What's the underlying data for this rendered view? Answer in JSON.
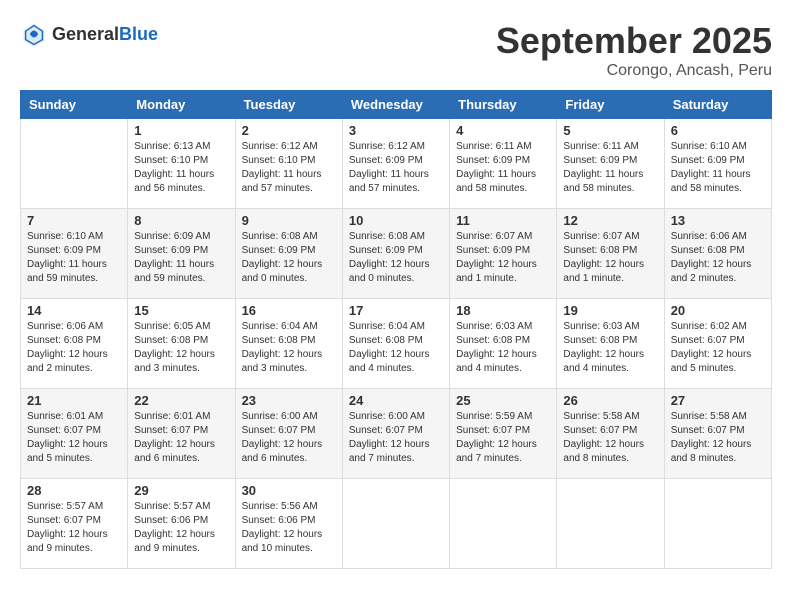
{
  "logo": {
    "text_general": "General",
    "text_blue": "Blue"
  },
  "header": {
    "month": "September 2025",
    "location": "Corongo, Ancash, Peru"
  },
  "weekdays": [
    "Sunday",
    "Monday",
    "Tuesday",
    "Wednesday",
    "Thursday",
    "Friday",
    "Saturday"
  ],
  "weeks": [
    [
      {
        "day": "",
        "info": ""
      },
      {
        "day": "1",
        "info": "Sunrise: 6:13 AM\nSunset: 6:10 PM\nDaylight: 11 hours\nand 56 minutes."
      },
      {
        "day": "2",
        "info": "Sunrise: 6:12 AM\nSunset: 6:10 PM\nDaylight: 11 hours\nand 57 minutes."
      },
      {
        "day": "3",
        "info": "Sunrise: 6:12 AM\nSunset: 6:09 PM\nDaylight: 11 hours\nand 57 minutes."
      },
      {
        "day": "4",
        "info": "Sunrise: 6:11 AM\nSunset: 6:09 PM\nDaylight: 11 hours\nand 58 minutes."
      },
      {
        "day": "5",
        "info": "Sunrise: 6:11 AM\nSunset: 6:09 PM\nDaylight: 11 hours\nand 58 minutes."
      },
      {
        "day": "6",
        "info": "Sunrise: 6:10 AM\nSunset: 6:09 PM\nDaylight: 11 hours\nand 58 minutes."
      }
    ],
    [
      {
        "day": "7",
        "info": "Sunrise: 6:10 AM\nSunset: 6:09 PM\nDaylight: 11 hours\nand 59 minutes."
      },
      {
        "day": "8",
        "info": "Sunrise: 6:09 AM\nSunset: 6:09 PM\nDaylight: 11 hours\nand 59 minutes."
      },
      {
        "day": "9",
        "info": "Sunrise: 6:08 AM\nSunset: 6:09 PM\nDaylight: 12 hours\nand 0 minutes."
      },
      {
        "day": "10",
        "info": "Sunrise: 6:08 AM\nSunset: 6:09 PM\nDaylight: 12 hours\nand 0 minutes."
      },
      {
        "day": "11",
        "info": "Sunrise: 6:07 AM\nSunset: 6:09 PM\nDaylight: 12 hours\nand 1 minute."
      },
      {
        "day": "12",
        "info": "Sunrise: 6:07 AM\nSunset: 6:08 PM\nDaylight: 12 hours\nand 1 minute."
      },
      {
        "day": "13",
        "info": "Sunrise: 6:06 AM\nSunset: 6:08 PM\nDaylight: 12 hours\nand 2 minutes."
      }
    ],
    [
      {
        "day": "14",
        "info": "Sunrise: 6:06 AM\nSunset: 6:08 PM\nDaylight: 12 hours\nand 2 minutes."
      },
      {
        "day": "15",
        "info": "Sunrise: 6:05 AM\nSunset: 6:08 PM\nDaylight: 12 hours\nand 3 minutes."
      },
      {
        "day": "16",
        "info": "Sunrise: 6:04 AM\nSunset: 6:08 PM\nDaylight: 12 hours\nand 3 minutes."
      },
      {
        "day": "17",
        "info": "Sunrise: 6:04 AM\nSunset: 6:08 PM\nDaylight: 12 hours\nand 4 minutes."
      },
      {
        "day": "18",
        "info": "Sunrise: 6:03 AM\nSunset: 6:08 PM\nDaylight: 12 hours\nand 4 minutes."
      },
      {
        "day": "19",
        "info": "Sunrise: 6:03 AM\nSunset: 6:08 PM\nDaylight: 12 hours\nand 4 minutes."
      },
      {
        "day": "20",
        "info": "Sunrise: 6:02 AM\nSunset: 6:07 PM\nDaylight: 12 hours\nand 5 minutes."
      }
    ],
    [
      {
        "day": "21",
        "info": "Sunrise: 6:01 AM\nSunset: 6:07 PM\nDaylight: 12 hours\nand 5 minutes."
      },
      {
        "day": "22",
        "info": "Sunrise: 6:01 AM\nSunset: 6:07 PM\nDaylight: 12 hours\nand 6 minutes."
      },
      {
        "day": "23",
        "info": "Sunrise: 6:00 AM\nSunset: 6:07 PM\nDaylight: 12 hours\nand 6 minutes."
      },
      {
        "day": "24",
        "info": "Sunrise: 6:00 AM\nSunset: 6:07 PM\nDaylight: 12 hours\nand 7 minutes."
      },
      {
        "day": "25",
        "info": "Sunrise: 5:59 AM\nSunset: 6:07 PM\nDaylight: 12 hours\nand 7 minutes."
      },
      {
        "day": "26",
        "info": "Sunrise: 5:58 AM\nSunset: 6:07 PM\nDaylight: 12 hours\nand 8 minutes."
      },
      {
        "day": "27",
        "info": "Sunrise: 5:58 AM\nSunset: 6:07 PM\nDaylight: 12 hours\nand 8 minutes."
      }
    ],
    [
      {
        "day": "28",
        "info": "Sunrise: 5:57 AM\nSunset: 6:07 PM\nDaylight: 12 hours\nand 9 minutes."
      },
      {
        "day": "29",
        "info": "Sunrise: 5:57 AM\nSunset: 6:06 PM\nDaylight: 12 hours\nand 9 minutes."
      },
      {
        "day": "30",
        "info": "Sunrise: 5:56 AM\nSunset: 6:06 PM\nDaylight: 12 hours\nand 10 minutes."
      },
      {
        "day": "",
        "info": ""
      },
      {
        "day": "",
        "info": ""
      },
      {
        "day": "",
        "info": ""
      },
      {
        "day": "",
        "info": ""
      }
    ]
  ]
}
